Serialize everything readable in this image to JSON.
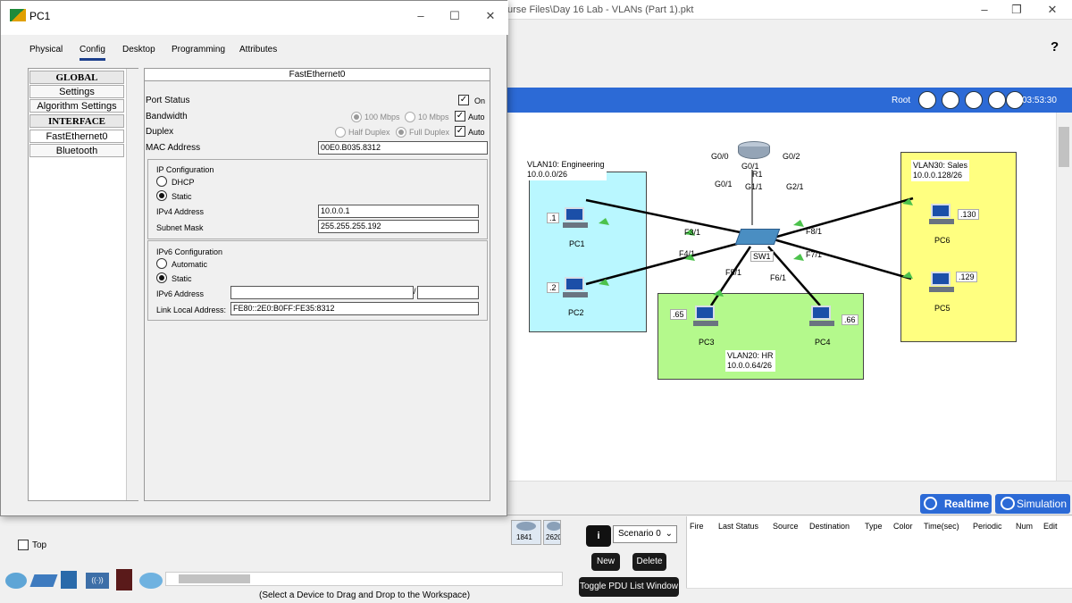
{
  "main_window": {
    "title_suffix": "urse Files\\Day 16 Lab - VLANs (Part 1).pkt",
    "help": "?",
    "root": "Root",
    "clock": "03:53:30"
  },
  "network": {
    "zones": [
      {
        "id": "vlan10",
        "label": "VLAN10: Engineering\n10.0.0.0/26",
        "color": "#b9f7ff"
      },
      {
        "id": "vlan20",
        "label": "VLAN20: HR\n10.0.0.64/26",
        "color": "#b4f98c"
      },
      {
        "id": "vlan30",
        "label": "VLAN30: Sales\n10.0.0.128/26",
        "color": "#ffff80"
      }
    ],
    "router": {
      "name": "R1",
      "ports": [
        "G0/0",
        "G0/2",
        "G0/1"
      ]
    },
    "switch": {
      "name": "SW1",
      "ports": [
        "G0/1",
        "G1/1",
        "G2/1",
        "F3/1",
        "F4/1",
        "F5/1",
        "F6/1",
        "F7/1",
        "F8/1"
      ]
    },
    "pcs": [
      {
        "name": "PC1",
        "ip": ".1"
      },
      {
        "name": "PC2",
        "ip": ".2"
      },
      {
        "name": "PC3",
        "ip": ".65"
      },
      {
        "name": "PC4",
        "ip": ".66"
      },
      {
        "name": "PC5",
        "ip": ".129"
      },
      {
        "name": "PC6",
        "ip": ".130"
      }
    ]
  },
  "mode": {
    "realtime": "Realtime",
    "simulation": "Simulation"
  },
  "bottom": {
    "top_label": "Top",
    "status": "(Select a Device to Drag and Drop to the Workspace)",
    "device_models": [
      "1841",
      "2620"
    ],
    "scenario": "Scenario 0",
    "new_btn": "New",
    "delete_btn": "Delete",
    "toggle_btn": "Toggle PDU List Window",
    "pdu_headers": [
      "Fire",
      "Last Status",
      "Source",
      "Destination",
      "Type",
      "Color",
      "Time(sec)",
      "Periodic",
      "Num",
      "Edit"
    ]
  },
  "dialog": {
    "title": "PC1",
    "tabs": [
      "Physical",
      "Config",
      "Desktop",
      "Programming",
      "Attributes"
    ],
    "active_tab": "Config",
    "sidebar": [
      "GLOBAL",
      "Settings",
      "Algorithm Settings",
      "INTERFACE",
      "FastEthernet0",
      "Bluetooth"
    ],
    "panel_title": "FastEthernet0",
    "port_status": {
      "label": "Port Status",
      "on_label": "On",
      "on": true
    },
    "bandwidth": {
      "label": "Bandwidth",
      "opt1": "100 Mbps",
      "opt2": "10 Mbps",
      "auto": "Auto"
    },
    "duplex": {
      "label": "Duplex",
      "opt1": "Half Duplex",
      "opt2": "Full Duplex",
      "auto": "Auto"
    },
    "mac": {
      "label": "MAC Address",
      "value": "00E0.B035.8312"
    },
    "ipv4": {
      "group": "IP Configuration",
      "dhcp": "DHCP",
      "static": "Static",
      "addr_label": "IPv4 Address",
      "addr": "10.0.0.1",
      "mask_label": "Subnet Mask",
      "mask": "255.255.255.192"
    },
    "ipv6": {
      "group": "IPv6 Configuration",
      "auto": "Automatic",
      "static": "Static",
      "addr_label": "IPv6 Address",
      "addr": "",
      "prefix": "",
      "ll_label": "Link Local Address:",
      "ll": "FE80::2E0:B0FF:FE35:8312"
    }
  }
}
